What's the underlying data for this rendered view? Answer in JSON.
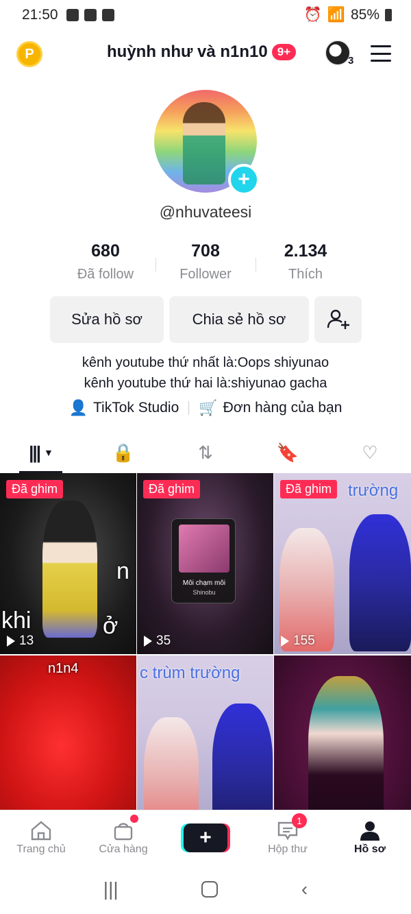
{
  "status_bar": {
    "time": "21:50",
    "battery": "85%"
  },
  "header": {
    "title": "huỳnh như và n1n10",
    "badge": "9+",
    "account_count": "3",
    "points_label": "P"
  },
  "profile": {
    "username": "@nhuvateesi",
    "stats": [
      {
        "value": "680",
        "label": "Đã follow"
      },
      {
        "value": "708",
        "label": "Follower"
      },
      {
        "value": "2.134",
        "label": "Thích"
      }
    ],
    "buttons": {
      "edit": "Sửa hồ sơ",
      "share": "Chia sẻ hồ sơ"
    },
    "bio": [
      "kênh youtube thứ nhất là:Oops shiyunao",
      "kênh youtube thứ hai là:shiyunao gacha"
    ],
    "links": {
      "studio": "TikTok Studio",
      "orders": "Đơn hàng của bạn"
    }
  },
  "videos": [
    {
      "pinned": "Đã ghim",
      "views": "13",
      "overlay": "khi",
      "overlay2": "ở",
      "overlay3": "n"
    },
    {
      "pinned": "Đã ghim",
      "views": "35",
      "music_title": "Môi chạm môi",
      "music_artist": "Shinobu"
    },
    {
      "pinned": "Đã ghim",
      "views": "155",
      "overlay": "trường"
    },
    {
      "overlay": "n1n4"
    },
    {
      "overlay": "c trùm trường"
    },
    {}
  ],
  "bottom_nav": [
    {
      "label": "Trang chủ"
    },
    {
      "label": "Cửa hàng"
    },
    {
      "label": ""
    },
    {
      "label": "Hộp thư",
      "badge": "1"
    },
    {
      "label": "Hồ sơ"
    }
  ],
  "colors": {
    "accent": "#fe2c55",
    "cyan": "#20d5ec"
  }
}
